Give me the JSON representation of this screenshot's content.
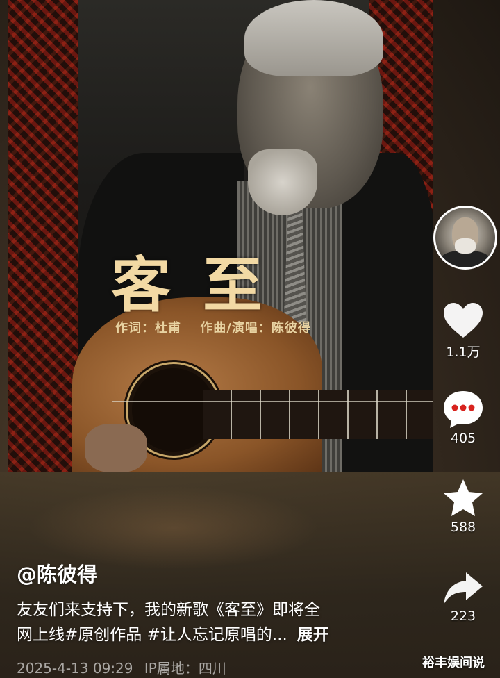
{
  "video": {
    "title_art": "客至",
    "credits": {
      "lyrics": "作词：杜甫",
      "music_vocal": "作曲/演唱：陈彼得"
    }
  },
  "rail": {
    "avatar_icon": "creator-avatar",
    "like": {
      "icon": "heart-icon",
      "count": "1.1万"
    },
    "comment": {
      "icon": "comment-bubble-icon",
      "count": "405"
    },
    "favorite": {
      "icon": "star-icon",
      "count": "588"
    },
    "share": {
      "icon": "share-arrow-icon",
      "count": "223"
    }
  },
  "post": {
    "author": "@陈彼得",
    "caption_line1": "友友们来支持下，我的新歌《客至》即将全",
    "caption_line2": "网上线#原创作品 #让人忘记原唱的...",
    "expand_label": "展开",
    "date": "2025-4-13 09:29",
    "ip_location": "IP属地：四川"
  },
  "watermark": "裕丰娱间说"
}
